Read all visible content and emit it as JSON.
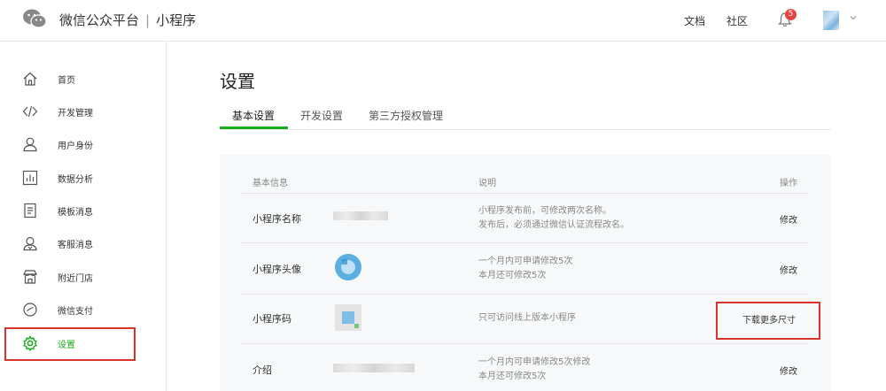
{
  "topbar": {
    "brand": "微信公众平台",
    "separator": "|",
    "product": "小程序",
    "links": [
      "文档",
      "社区"
    ],
    "notification_count": "5"
  },
  "sidebar": {
    "items": [
      {
        "label": "首页",
        "icon": "home-icon"
      },
      {
        "label": "开发管理",
        "icon": "code-icon"
      },
      {
        "label": "用户身份",
        "icon": "user-icon"
      },
      {
        "label": "数据分析",
        "icon": "chart-icon"
      },
      {
        "label": "模板消息",
        "icon": "document-icon"
      },
      {
        "label": "客服消息",
        "icon": "customer-service-icon"
      },
      {
        "label": "附近门店",
        "icon": "store-icon"
      },
      {
        "label": "微信支付",
        "icon": "payment-icon"
      },
      {
        "label": "设置",
        "icon": "gear-icon"
      }
    ],
    "active_index": 8
  },
  "main": {
    "title": "设置",
    "tabs": [
      "基本设置",
      "开发设置",
      "第三方授权管理"
    ],
    "active_tab": 0
  },
  "table": {
    "headers": [
      "基本信息",
      "说明",
      "操作"
    ],
    "rows": [
      {
        "label": "小程序名称",
        "desc": [
          "小程序发布前，可修改两次名称。",
          "发布后，必须通过微信认证流程改名。"
        ],
        "action": "修改"
      },
      {
        "label": "小程序头像",
        "desc": [
          "一个月内可申请修改5次",
          "本月还可修改5次"
        ],
        "action": "修改"
      },
      {
        "label": "小程序码",
        "desc": [
          "只可访问线上版本小程序"
        ],
        "action": "下载更多尺寸"
      },
      {
        "label": "介绍",
        "desc": [
          "一个月内可申请修改5次修改",
          "本月还可修改5次"
        ],
        "action": "修改"
      }
    ]
  },
  "colors": {
    "accent": "#1aad19",
    "highlight": "#d9342b",
    "badge": "#e64340"
  }
}
